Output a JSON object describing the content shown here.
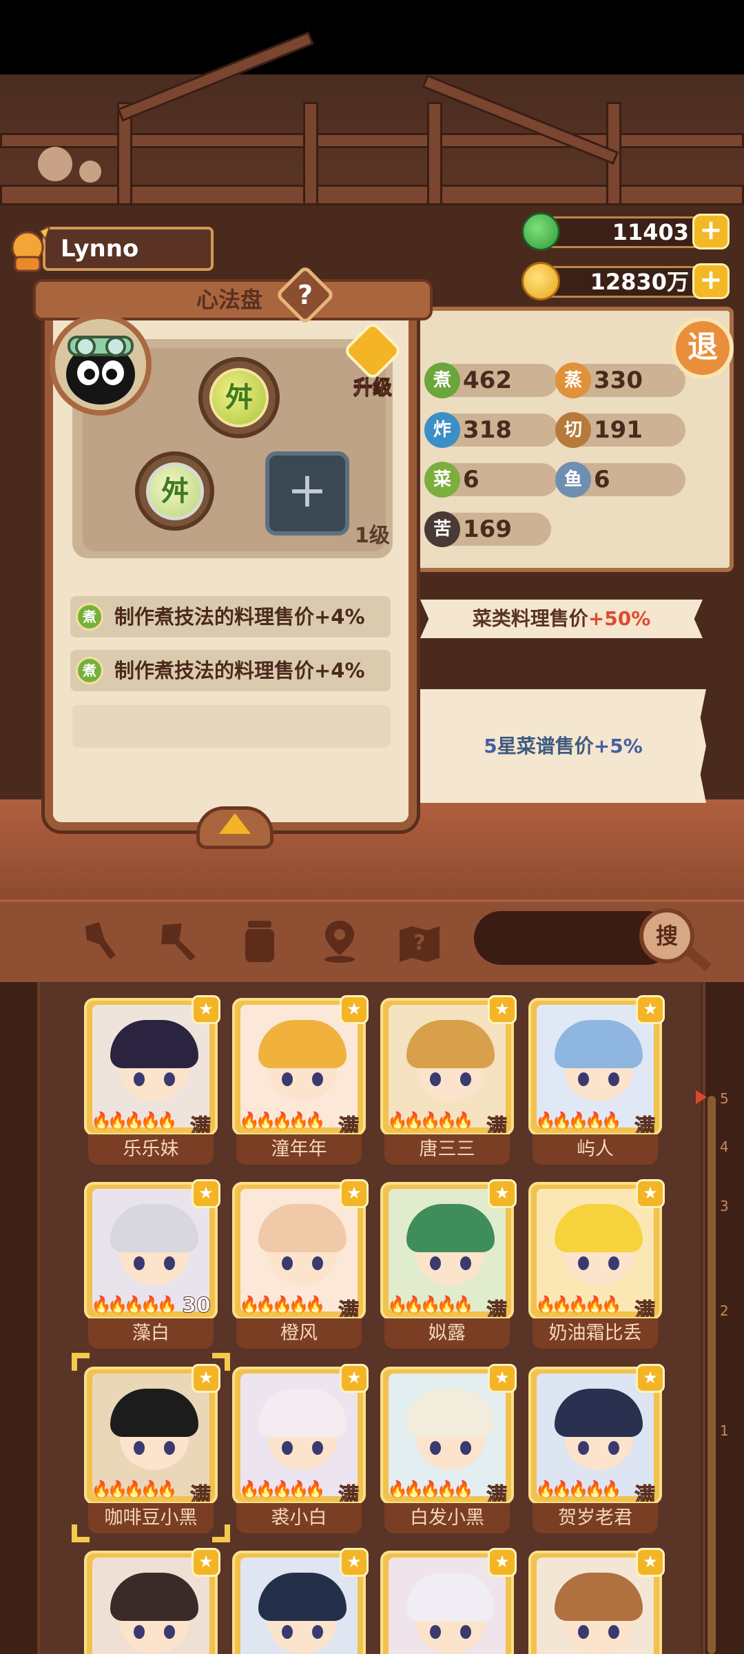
{
  "player": {
    "name": "Lynno"
  },
  "currency": {
    "jade": {
      "value": "11403",
      "icon": "jade-icon",
      "plus": "+"
    },
    "coins": {
      "value": "12830万",
      "icon": "coin-icon",
      "plus": "+"
    }
  },
  "exit_label": "退",
  "panel": {
    "title": "心法盘",
    "help": "?",
    "upgrade_label": "升级",
    "level": "1级",
    "add_slot": "+",
    "skill_icon_glyph": "⾇",
    "effects": [
      {
        "icon": "煮",
        "text": "制作煮技法的料理售价+4%"
      },
      {
        "icon": "煮",
        "text": "制作煮技法的料理售价+4%"
      }
    ]
  },
  "stats": [
    {
      "label": "煮",
      "value": "462",
      "color": "#6aa63a"
    },
    {
      "label": "蒸",
      "value": "330",
      "color": "#e0913a"
    },
    {
      "label": "炸",
      "value": "318",
      "color": "#3b8fc6"
    },
    {
      "label": "切",
      "value": "191",
      "color": "#b77a3a"
    },
    {
      "label": "菜",
      "value": "6",
      "color": "#7cae3e"
    },
    {
      "label": "鱼",
      "value": "6",
      "color": "#6f8fb0"
    },
    {
      "label": "苦",
      "value": "169",
      "color": "#4a3a36"
    }
  ],
  "bonuses": {
    "b1_prefix": "菜类料理售价",
    "b1_value": "+50%",
    "b2_star": "5",
    "b2_mid": "星菜谱售价",
    "b2_value": "+5%"
  },
  "toolbar": {
    "tools": [
      "shovel-icon",
      "trowel-icon",
      "jar-icon",
      "location-icon",
      "map-help-icon"
    ],
    "search_label": "搜"
  },
  "ruler_labels": [
    "5",
    "4",
    "3",
    "2",
    "1"
  ],
  "chefs": [
    {
      "name": "乐乐妹",
      "badge": "满",
      "hair": "#2b2440",
      "bg": "#efe4dc"
    },
    {
      "name": "潼年年",
      "badge": "满",
      "hair": "#f0b23c",
      "bg": "#fbe8d8"
    },
    {
      "name": "唐三三",
      "badge": "满",
      "hair": "#d8a04a",
      "bg": "#f4e2c0"
    },
    {
      "name": "屿人",
      "badge": "满",
      "hair": "#8fb6e0",
      "bg": "#dfe8f4"
    },
    {
      "name": "藻白",
      "badge": "30",
      "hair": "#d8d6de",
      "bg": "#e9e4ec"
    },
    {
      "name": "橙风",
      "badge": "满",
      "hair": "#f0c9a8",
      "bg": "#fbe8d8"
    },
    {
      "name": "姒露",
      "badge": "满",
      "hair": "#3f8d5a",
      "bg": "#e0eccc"
    },
    {
      "name": "奶油霜比丢",
      "badge": "满",
      "hair": "#f6d23c",
      "bg": "#fbe7b4"
    },
    {
      "name": "咖啡豆小黑",
      "badge": "满",
      "hair": "#1c1c1c",
      "bg": "#e9d7b8"
    },
    {
      "name": "裘小白",
      "badge": "满",
      "hair": "#f4ecf0",
      "bg": "#ece4ee"
    },
    {
      "name": "白发小黑",
      "badge": "满",
      "hair": "#f2ecdc",
      "bg": "#e2eef0"
    },
    {
      "name": "贺岁老君",
      "badge": "满",
      "hair": "#2a3050",
      "bg": "#dde4f2"
    },
    {
      "name": "",
      "badge": "",
      "hair": "#3a2a28",
      "bg": "#efe0d6"
    },
    {
      "name": "",
      "badge": "",
      "hair": "#24304a",
      "bg": "#dfe6f2"
    },
    {
      "name": "",
      "badge": "",
      "hair": "#f0eef4",
      "bg": "#efe4ea"
    },
    {
      "name": "",
      "badge": "",
      "hair": "#b07040",
      "bg": "#f3e6d4"
    }
  ]
}
